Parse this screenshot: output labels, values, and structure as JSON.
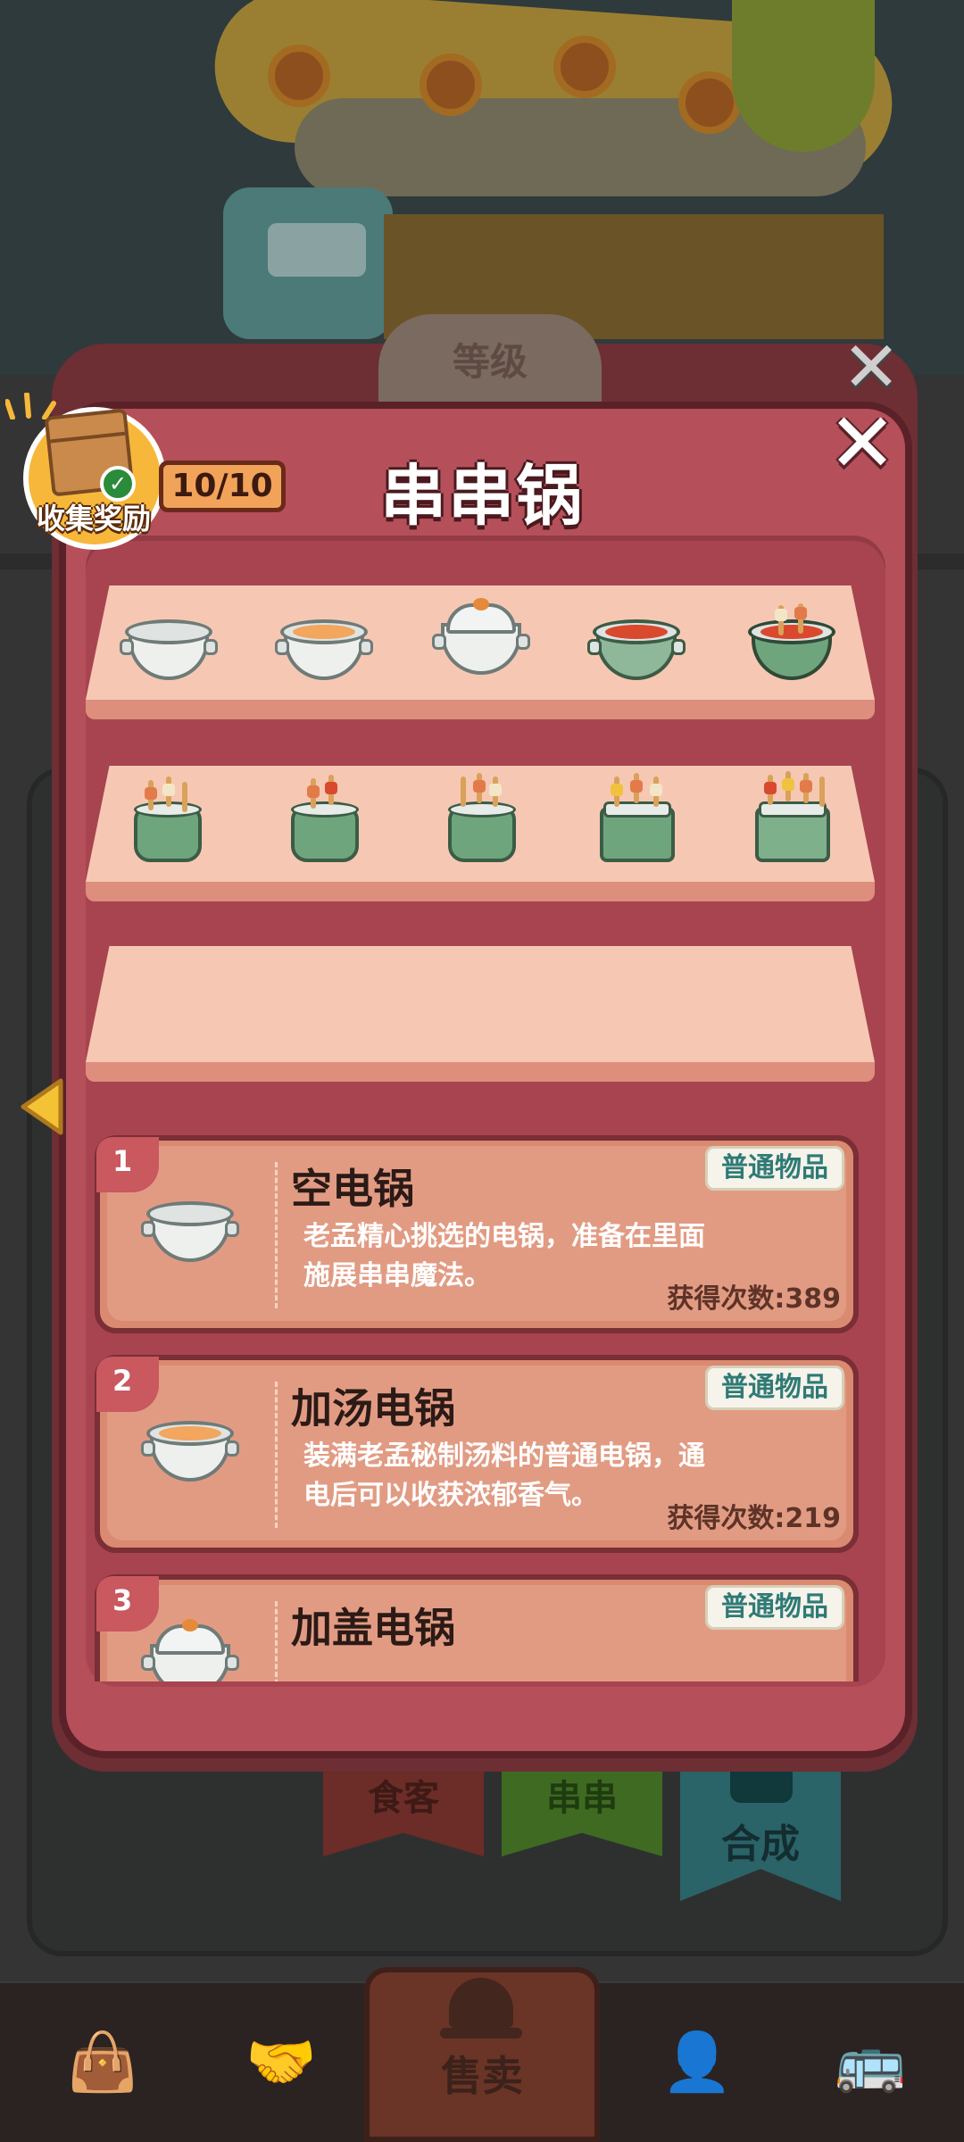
{
  "modal": {
    "title": "串串锅",
    "close_icon": "close-icon",
    "level_badge": "等级",
    "reward": {
      "label": "收集奖励",
      "icon": "package-box-icon",
      "progress": "10/10"
    }
  },
  "collection": {
    "shelf_1": [
      {
        "id": 1,
        "icon": "empty-pot-icon"
      },
      {
        "id": 2,
        "icon": "soup-pot-icon"
      },
      {
        "id": 3,
        "icon": "lidded-pot-icon"
      },
      {
        "id": 4,
        "icon": "hotpot-icon"
      },
      {
        "id": 5,
        "icon": "skewer-pot-icon"
      }
    ],
    "shelf_2": [
      {
        "id": 6,
        "icon": "skewer-cooker-icon"
      },
      {
        "id": 7,
        "icon": "skewer-cooker-icon"
      },
      {
        "id": 8,
        "icon": "skewer-cooker-icon"
      },
      {
        "id": 9,
        "icon": "skewer-fryer-icon"
      },
      {
        "id": 10,
        "icon": "skewer-steamer-icon"
      }
    ],
    "shelf_3": []
  },
  "details": [
    {
      "num": "1",
      "name": "空电锅",
      "rarity": "普通物品",
      "desc": "老孟精心挑选的电锅，准备在里面施展串串魔法。",
      "count": "获得次数:389"
    },
    {
      "num": "2",
      "name": "加汤电锅",
      "rarity": "普通物品",
      "desc": "装满老孟秘制汤料的普通电锅，通电后可以收获浓郁香气。",
      "count": "获得次数:219"
    },
    {
      "num": "3",
      "name": "加盖电锅",
      "rarity": "普通物品",
      "desc": "",
      "count": ""
    }
  ],
  "background": {
    "flags": [
      "食客",
      "串串",
      "合成"
    ]
  },
  "bottom_nav": {
    "items": [
      {
        "icon": "bag-icon",
        "label": ""
      },
      {
        "icon": "handshake-icon",
        "label": ""
      },
      {
        "icon": "bell-icon",
        "label": "售卖"
      },
      {
        "icon": "person-icon",
        "label": ""
      },
      {
        "icon": "bus-icon",
        "label": ""
      }
    ]
  },
  "colors": {
    "modal": "#b5505a",
    "shelf": "#f6c8b3",
    "card": "#e29b83",
    "rarity_text": "#2f7a76"
  }
}
